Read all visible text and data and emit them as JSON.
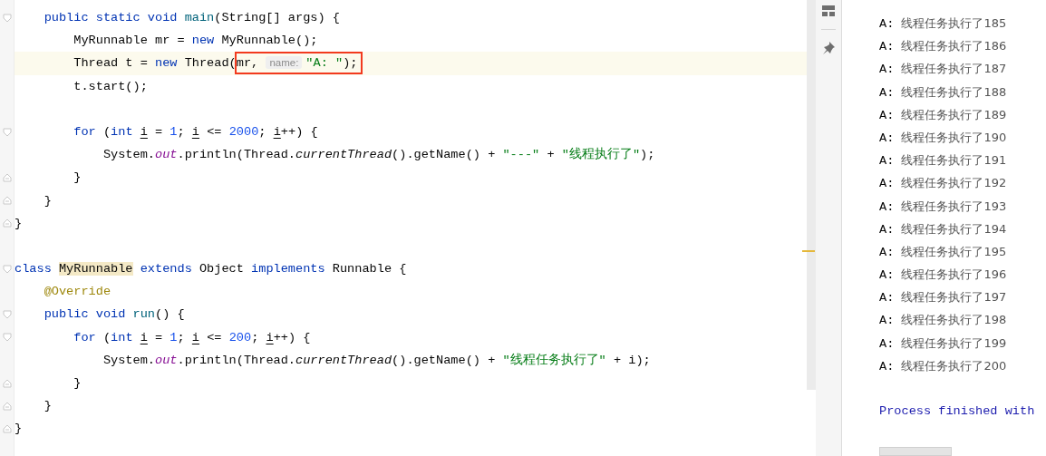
{
  "editor": {
    "lines": [
      {
        "kind": "code",
        "fold_start": true,
        "tokens": [
          {
            "kind": "keyword",
            "text": "    public static void "
          },
          {
            "kind": "method",
            "text": "main"
          },
          {
            "kind": "plain",
            "text": "(String[] args) {"
          }
        ]
      },
      {
        "kind": "code",
        "tokens": [
          {
            "kind": "plain",
            "text": "        MyRunnable mr = "
          },
          {
            "kind": "keyword",
            "text": "new"
          },
          {
            "kind": "plain",
            "text": " MyRunnable();"
          }
        ]
      },
      {
        "kind": "code",
        "current": true,
        "tokens": [
          {
            "kind": "plain",
            "text": "        Thread t = "
          },
          {
            "kind": "keyword",
            "text": "new"
          },
          {
            "kind": "plain",
            "text": " Thread("
          },
          {
            "kind": "plain",
            "text": "mr, ",
            "boxed": true
          },
          {
            "kind": "hint",
            "text": "name:",
            "boxed": true
          },
          {
            "kind": "string",
            "text": "\"A: \"",
            "boxed": true
          },
          {
            "kind": "plain",
            "text": ");",
            "boxed": true
          }
        ]
      },
      {
        "kind": "code",
        "tokens": [
          {
            "kind": "plain",
            "text": "        t.start();"
          }
        ]
      },
      {
        "kind": "blank"
      },
      {
        "kind": "code",
        "fold_start": true,
        "tokens": [
          {
            "kind": "keyword",
            "text": "        for"
          },
          {
            "kind": "plain",
            "text": " ("
          },
          {
            "kind": "keyword",
            "text": "int "
          },
          {
            "kind": "var",
            "text": "i"
          },
          {
            "kind": "plain",
            "text": " = "
          },
          {
            "kind": "number",
            "text": "1"
          },
          {
            "kind": "plain",
            "text": "; "
          },
          {
            "kind": "var",
            "text": "i"
          },
          {
            "kind": "plain",
            "text": " <= "
          },
          {
            "kind": "number",
            "text": "2000"
          },
          {
            "kind": "plain",
            "text": "; "
          },
          {
            "kind": "var",
            "text": "i"
          },
          {
            "kind": "plain",
            "text": "++) {"
          }
        ]
      },
      {
        "kind": "code",
        "tokens": [
          {
            "kind": "plain",
            "text": "            System."
          },
          {
            "kind": "field",
            "text": "out"
          },
          {
            "kind": "plain",
            "text": ".println(Thread."
          },
          {
            "kind": "static_call",
            "text": "currentThread"
          },
          {
            "kind": "plain",
            "text": "().getName() + "
          },
          {
            "kind": "string",
            "text": "\"---\""
          },
          {
            "kind": "plain",
            "text": " + "
          },
          {
            "kind": "string",
            "text": "\"线程执行了\""
          },
          {
            "kind": "plain",
            "text": ");"
          }
        ]
      },
      {
        "kind": "code",
        "fold_end": true,
        "tokens": [
          {
            "kind": "plain",
            "text": "        }"
          }
        ]
      },
      {
        "kind": "code",
        "fold_end": true,
        "tokens": [
          {
            "kind": "plain",
            "text": "    }"
          }
        ]
      },
      {
        "kind": "code",
        "fold_end": true,
        "tokens": [
          {
            "kind": "plain",
            "text": "}"
          }
        ]
      },
      {
        "kind": "blank"
      },
      {
        "kind": "code",
        "fold_start": true,
        "tokens": [
          {
            "kind": "keyword",
            "text": "class "
          },
          {
            "kind": "declared",
            "text": "MyRunnable"
          },
          {
            "kind": "keyword",
            "text": " extends"
          },
          {
            "kind": "plain",
            "text": " Object "
          },
          {
            "kind": "keyword",
            "text": "implements"
          },
          {
            "kind": "plain",
            "text": " Runnable {"
          }
        ]
      },
      {
        "kind": "code",
        "tokens": [
          {
            "kind": "annotation",
            "text": "    @Override"
          }
        ]
      },
      {
        "kind": "code",
        "fold_start": true,
        "tokens": [
          {
            "kind": "keyword",
            "text": "    public void "
          },
          {
            "kind": "method",
            "text": "run"
          },
          {
            "kind": "plain",
            "text": "() {"
          }
        ]
      },
      {
        "kind": "code",
        "fold_start": true,
        "tokens": [
          {
            "kind": "keyword",
            "text": "        for"
          },
          {
            "kind": "plain",
            "text": " ("
          },
          {
            "kind": "keyword",
            "text": "int "
          },
          {
            "kind": "var",
            "text": "i"
          },
          {
            "kind": "plain",
            "text": " = "
          },
          {
            "kind": "number",
            "text": "1"
          },
          {
            "kind": "plain",
            "text": "; "
          },
          {
            "kind": "var",
            "text": "i"
          },
          {
            "kind": "plain",
            "text": " <= "
          },
          {
            "kind": "number",
            "text": "200"
          },
          {
            "kind": "plain",
            "text": "; "
          },
          {
            "kind": "var",
            "text": "i"
          },
          {
            "kind": "plain",
            "text": "++) {"
          }
        ]
      },
      {
        "kind": "code",
        "tokens": [
          {
            "kind": "plain",
            "text": "            System."
          },
          {
            "kind": "field",
            "text": "out"
          },
          {
            "kind": "plain",
            "text": ".println(Thread."
          },
          {
            "kind": "static_call",
            "text": "currentThread"
          },
          {
            "kind": "plain",
            "text": "().getName() + "
          },
          {
            "kind": "string",
            "text": "\"线程任务执行了\""
          },
          {
            "kind": "plain",
            "text": " + i);"
          }
        ]
      },
      {
        "kind": "code",
        "fold_end": true,
        "tokens": [
          {
            "kind": "plain",
            "text": "        }"
          }
        ]
      },
      {
        "kind": "code",
        "fold_end": true,
        "tokens": [
          {
            "kind": "plain",
            "text": "    }"
          }
        ]
      },
      {
        "kind": "code",
        "fold_end": true,
        "tokens": [
          {
            "kind": "plain",
            "text": "}"
          }
        ]
      }
    ]
  },
  "console": {
    "lines": [
      {
        "kind": "output",
        "prefix": "A: ",
        "text": "线程任务执行了185"
      },
      {
        "kind": "output",
        "prefix": "A: ",
        "text": "线程任务执行了186"
      },
      {
        "kind": "output",
        "prefix": "A: ",
        "text": "线程任务执行了187"
      },
      {
        "kind": "output",
        "prefix": "A: ",
        "text": "线程任务执行了188"
      },
      {
        "kind": "output",
        "prefix": "A: ",
        "text": "线程任务执行了189"
      },
      {
        "kind": "output",
        "prefix": "A: ",
        "text": "线程任务执行了190"
      },
      {
        "kind": "output",
        "prefix": "A: ",
        "text": "线程任务执行了191"
      },
      {
        "kind": "output",
        "prefix": "A: ",
        "text": "线程任务执行了192"
      },
      {
        "kind": "output",
        "prefix": "A: ",
        "text": "线程任务执行了193"
      },
      {
        "kind": "output",
        "prefix": "A: ",
        "text": "线程任务执行了194"
      },
      {
        "kind": "output",
        "prefix": "A: ",
        "text": "线程任务执行了195"
      },
      {
        "kind": "output",
        "prefix": "A: ",
        "text": "线程任务执行了196"
      },
      {
        "kind": "output",
        "prefix": "A: ",
        "text": "线程任务执行了197"
      },
      {
        "kind": "output",
        "prefix": "A: ",
        "text": "线程任务执行了198"
      },
      {
        "kind": "output",
        "prefix": "A: ",
        "text": "线程任务执行了199"
      },
      {
        "kind": "output",
        "prefix": "A: ",
        "text": "线程任务执行了200"
      },
      {
        "kind": "blank"
      },
      {
        "kind": "system",
        "text": "Process finished with"
      }
    ]
  }
}
